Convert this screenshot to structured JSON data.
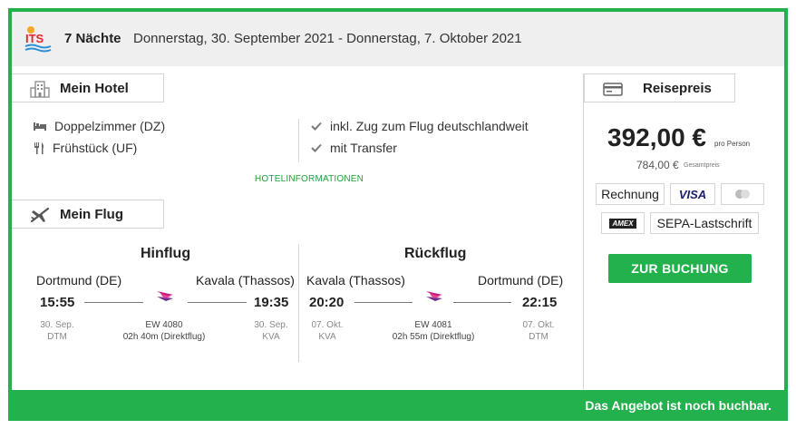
{
  "header": {
    "logo_text": "ITS",
    "nights": "7 Nächte",
    "dates": "Donnerstag, 30. September 2021 - Donnerstag, 7. Oktober 2021"
  },
  "hotel": {
    "tab_label": "Mein Hotel",
    "room": "Doppelzimmer (DZ)",
    "board": "Frühstück (UF)",
    "extras": [
      "inkl. Zug zum Flug deutschlandweit",
      "mit Transfer"
    ],
    "info_link": "HOTELINFORMATIONEN"
  },
  "flight": {
    "tab_label": "Mein Flug",
    "outbound": {
      "title": "Hinflug",
      "from_city": "Dortmund (DE)",
      "to_city": "Kavala (Thassos)",
      "dep_time": "15:55",
      "arr_time": "19:35",
      "dep_date": "30. Sep.",
      "dep_code": "DTM",
      "arr_date": "30. Sep.",
      "arr_code": "KVA",
      "flight_no": "EW 4080",
      "duration": "02h 40m (Direktflug)"
    },
    "return": {
      "title": "Rückflug",
      "from_city": "Kavala (Thassos)",
      "to_city": "Dortmund (DE)",
      "dep_time": "20:20",
      "arr_time": "22:15",
      "dep_date": "07. Okt.",
      "dep_code": "KVA",
      "arr_date": "07. Okt.",
      "arr_code": "DTM",
      "flight_no": "EW 4081",
      "duration": "02h 55m (Direktflug)"
    }
  },
  "price": {
    "tab_label": "Reisepreis",
    "per_person": "392,00 €",
    "per_person_label": "pro Person",
    "total": "784,00 €",
    "total_label": "Gesamtpreis",
    "payment": {
      "invoice": "Rechnung",
      "visa": "VISA",
      "mastercard": "mastercard",
      "amex": "AMEX",
      "sepa": "SEPA-Lastschrift"
    },
    "book_label": "ZUR BUCHUNG"
  },
  "status": "Das Angebot ist noch buchbar.",
  "colors": {
    "accent": "#22b14c",
    "topbar": "#efefef",
    "border": "#d5d5d5"
  }
}
